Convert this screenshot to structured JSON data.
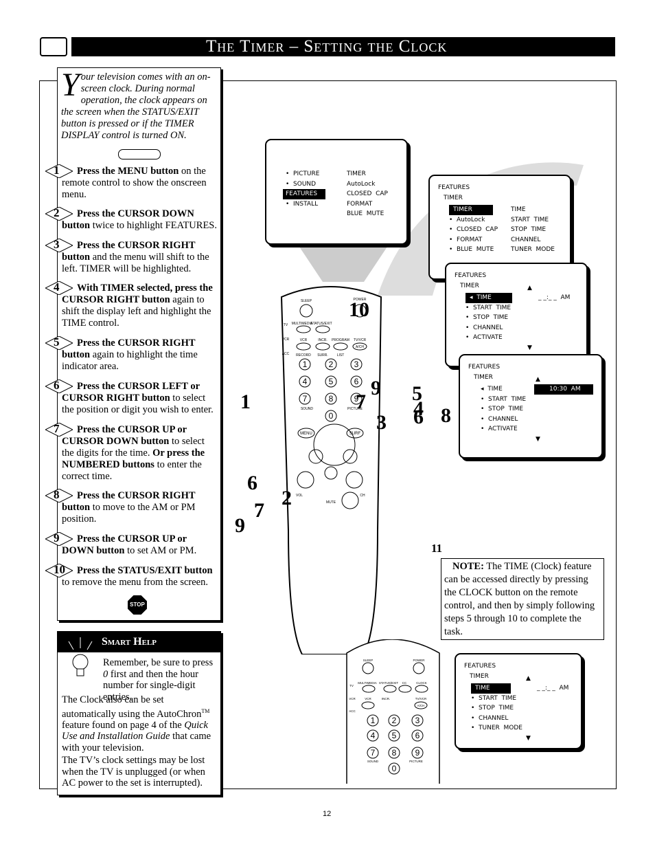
{
  "header": {
    "title": "The Timer – Setting the Clock"
  },
  "intro": {
    "drop_cap": "Y",
    "text": "our television comes with an on-screen clock.  During normal operation, the clock appears on the screen when the STATUS/EXIT button is pressed or if the TIMER DISPLAY control is turned ON."
  },
  "steps": [
    {
      "n": "1",
      "bold": "Press the MENU button",
      "rest": " on the remote control to show the onscreen menu."
    },
    {
      "n": "2",
      "bold": "Press the CURSOR DOWN button",
      "rest": " twice to highlight FEATURES."
    },
    {
      "n": "3",
      "bold": "Press the CURSOR RIGHT button",
      "rest": " and the menu will shift to the left. TIMER will be highlighted."
    },
    {
      "n": "4",
      "bold": "With TIMER selected, press the CURSOR RIGHT button",
      "rest": " again to shift the display left and highlight the TIME control."
    },
    {
      "n": "5",
      "bold": "Press the CURSOR RIGHT button",
      "rest": " again to highlight the time indicator area."
    },
    {
      "n": "6",
      "bold": "Press the CURSOR LEFT or CURSOR RIGHT button",
      "rest": " to select the position or digit you wish to enter."
    },
    {
      "n": "7",
      "bold": "Press the CURSOR UP or CURSOR DOWN button",
      "rest": " to select the digits for the time. ",
      "bold2": "Or press the NUMBERED buttons",
      "rest2": " to enter the correct time."
    },
    {
      "n": "8",
      "bold": "Press the CURSOR RIGHT button",
      "rest": " to move to the AM or PM  position."
    },
    {
      "n": "9",
      "bold": "Press the CURSOR UP or DOWN button",
      "rest": " to set AM or PM."
    },
    {
      "n": "10",
      "bold": "Press the STATUS/EXIT button",
      "rest": " to remove the menu from the screen."
    }
  ],
  "stop_label": "STOP",
  "smart_help": {
    "title": "Smart Help",
    "p1a": "Remember, be sure to press ",
    "p1b": "0",
    "p1c": " first and then the hour number for single-digit entries.",
    "p2a": "The Clock also can be set automatically using the AutoChron",
    "p2tm": "TM",
    "p2b": " feature found on page 4 of the ",
    "p2c": "Quick Use and Installation Guide",
    "p2d": " that came with your television.",
    "p3": "The TV’s clock settings may be lost when the TV is unplugged (or when AC power to the set is interrupted)."
  },
  "screens": {
    "s1": {
      "left": [
        "•  PICTURE",
        "•  SOUND",
        "FEATURES",
        "•  INSTALL"
      ],
      "right": [
        "TIMER",
        "AutoLock",
        "CLOSED  CAP",
        "FORMAT",
        "BLUE  MUTE"
      ]
    },
    "s2": {
      "h1": "FEATURES",
      "h2": "TIMER",
      "left": [
        "TIMER",
        "•  AutoLock",
        "•  CLOSED  CAP",
        "•  FORMAT",
        "•  BLUE  MUTE"
      ],
      "right": [
        "TIME",
        "START  TIME",
        "STOP  TIME",
        "CHANNEL",
        "TUNER  MODE"
      ]
    },
    "s3": {
      "h1": "FEATURES",
      "h2": "TIMER",
      "left": [
        "◂  TIME",
        "•  START  TIME",
        "•  STOP  TIME",
        "•  CHANNEL",
        "•  ACTIVATE"
      ],
      "value": "_ _:_ _  AM"
    },
    "s4": {
      "h1": "FEATURES",
      "h2": "TIMER",
      "left": [
        "◂  TIME",
        "•  START  TIME",
        "•  STOP  TIME",
        "•  CHANNEL",
        "•  ACTIVATE"
      ],
      "value": "10:30  AM"
    },
    "s5": {
      "h1": "FEATURES",
      "h2": "TIMER",
      "left": [
        "TIME",
        "•  START  TIME",
        "•  STOP  TIME",
        "•  CHANNEL",
        "•  TUNER  MODE"
      ],
      "value": "_ _:_ _  AM"
    }
  },
  "remote": {
    "labels": [
      "SLEEP",
      "POWER",
      "MULTIMEDIA",
      "STATUS/EXIT",
      "TV",
      "VCR",
      "ACC",
      "VCR",
      "INCR.",
      "PROGRAM",
      "TV/VCR",
      "RECORD",
      "SURR.",
      "LIST",
      "A/CH",
      "SOUND",
      "PICTURE",
      "MENU",
      "SURF",
      "VOL",
      "CH",
      "MUTE"
    ],
    "digits": [
      "1",
      "2",
      "3",
      "4",
      "5",
      "6",
      "7",
      "8",
      "9",
      "0"
    ]
  },
  "inset_remote": {
    "labels": [
      "SLEEP",
      "POWER",
      "MULTIMEDIA",
      "STATUS/EXIT",
      "CC",
      "CLOCK",
      "TV",
      "VCR",
      "ACC",
      "VCR",
      "INCR.",
      "TV/VCR",
      "A/CH",
      "SOUND",
      "PICTURE"
    ]
  },
  "callouts": [
    "1",
    "2",
    "3",
    "4",
    "5",
    "6",
    "7",
    "7",
    "7",
    "8",
    "9",
    "9",
    "10",
    "6",
    "11",
    "11"
  ],
  "note": {
    "bold": "NOTE:",
    "text": "  The TIME (Clock) feature can be accessed directly by pressing the CLOCK button on the remote control, and then by simply following steps 5 through 10 to complete the task."
  },
  "page_number": "12"
}
